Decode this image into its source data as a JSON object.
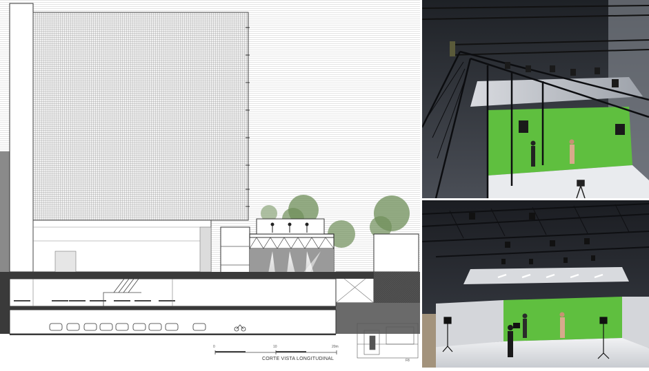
{
  "drawing": {
    "title": "CORTE VISTA LONGITUDINAL",
    "scale_labels": [
      "0",
      "10",
      "20m"
    ],
    "key_plan_label": "F8"
  },
  "renders": {
    "top": {
      "subject": "TV studio render with green screen, lighting truss and catwalk"
    },
    "bottom": {
      "subject": "TV studio render with green screen cyclorama and suspended ceiling lights"
    }
  },
  "colors": {
    "green_screen": "#5fbf3f",
    "studio_dark": "#2a2d33",
    "hatch": "#8a8a8a",
    "section_cut": "#3a3a3a",
    "tree": "#6f8f5a"
  }
}
